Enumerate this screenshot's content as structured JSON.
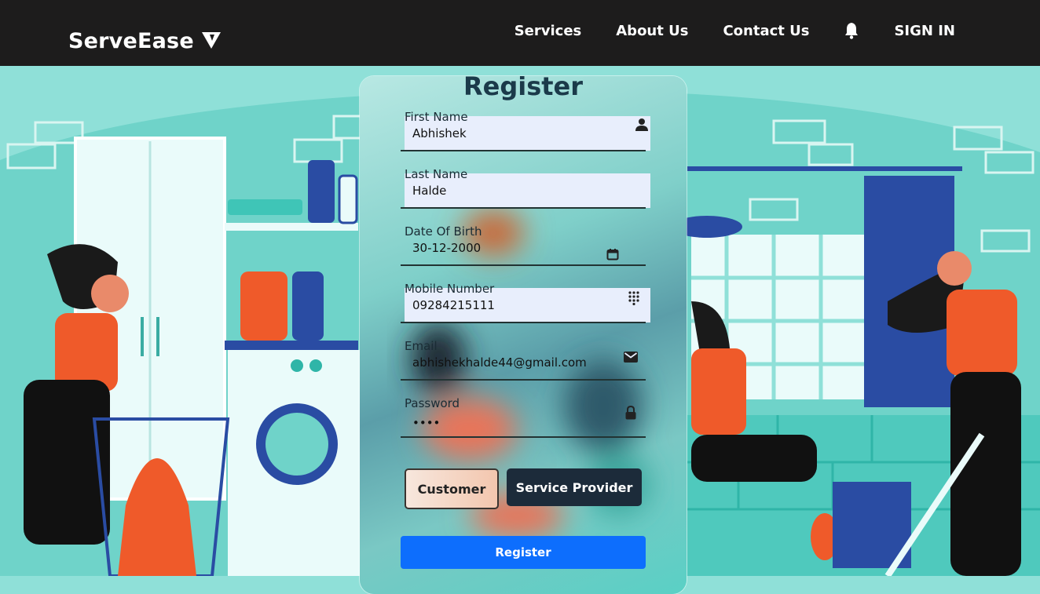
{
  "header": {
    "brand": "ServeEase",
    "nav": [
      "Services",
      "About Us",
      "Contact Us"
    ],
    "sign_in": "SIGN IN"
  },
  "form": {
    "title": "Register",
    "fields": [
      {
        "label": "First Name",
        "value": "Abhishek",
        "icon": "user-icon"
      },
      {
        "label": "Last Name",
        "value": "Halde",
        "icon": ""
      },
      {
        "label": "Date Of Birth",
        "value": "30-12-2000",
        "icon": "calendar-icon"
      },
      {
        "label": "Mobile Number",
        "value": "09284215111",
        "icon": "dialpad-icon"
      },
      {
        "label": "Email",
        "value": "abhishekhalde44@gmail.com",
        "icon": "mail-icon"
      },
      {
        "label": "Password",
        "value": "••••",
        "icon": "lock-icon"
      }
    ],
    "roles": [
      "Customer",
      "Service Provider"
    ],
    "submit": "Register"
  },
  "colors": {
    "header_bg": "#1d1c1c",
    "accent_blue": "#0d6efd",
    "teal_bg": "#8fe0d8",
    "input_fill": "#e8eefc"
  }
}
